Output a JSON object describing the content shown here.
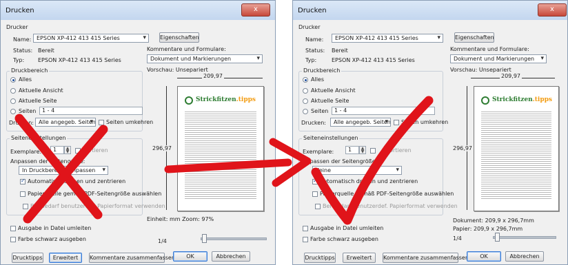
{
  "dialog": {
    "title": "Drucken",
    "close_glyph": "x",
    "printer": {
      "legend": "Drucker",
      "name_label": "Name:",
      "name_value": "EPSON XP-412 413 415 Series",
      "properties_button": "Eigenschaften",
      "status_label": "Status:",
      "status_value": "Bereit",
      "type_label": "Typ:",
      "type_value": "EPSON XP-412 413 415 Series",
      "comments_label": "Kommentare und Formulare:",
      "comments_value": "Dokument und Markierungen"
    },
    "range": {
      "legend": "Druckbereich",
      "all": "Alles",
      "current_view": "Aktuelle Ansicht",
      "current_page": "Aktuelle Seite",
      "pages": "Seiten",
      "pages_value": "1 - 4",
      "print_label": "Drucken:",
      "print_value": "Alle angegeb. Seiten",
      "reverse_pages": "Seiten umkehren"
    },
    "page_settings": {
      "legend": "Seiteneinstellungen",
      "copies_label": "Exemplare:",
      "copies_value": "1",
      "collate": "Sortieren",
      "scaling_label": "Anpassen der Seitengröße:",
      "left_scaling_value": "In Druckbereich einpassen",
      "right_scaling_value": "Keine",
      "auto_rotate": "Automatisch drehen und zentrieren",
      "choose_paper": "Papierquelle gemäß PDF-Seitengröße auswählen",
      "custom_paper": "Bei Bedarf benutzerdef. Papierformat verwenden"
    },
    "preview": {
      "label": "Vorschau: Unsepariert",
      "width": "209,97",
      "height": "296,97",
      "logo_text": "Strickfitzen",
      "logo_suffix": ".tipps",
      "left_footer": "Einheit: mm Zoom: 97%",
      "right_document": "Dokument: 209,9 x 296,7mm",
      "right_paper": "Papier: 209,9 x 296,7mm",
      "page_counter": "1/4"
    },
    "footer": {
      "print_to_file": "Ausgabe in Datei umleiten",
      "print_black": "Farbe schwarz ausgeben",
      "tips": "Drucktipps",
      "advanced": "Erweitert",
      "summarize": "Kommentare zusammenfassen",
      "ok": "OK",
      "cancel": "Abbrechen"
    }
  },
  "colors": {
    "annotation_red": "#e0141a",
    "logo_green": "#2e7d32",
    "logo_orange": "#f39c12"
  }
}
